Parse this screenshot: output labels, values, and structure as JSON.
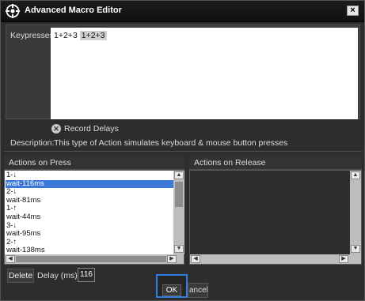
{
  "window": {
    "title": "Advanced Macro Editor",
    "close_glyph": "×"
  },
  "keypresses": {
    "label": "Keypresses:",
    "value_plain": "1+2+3",
    "value_selected": "1+2+3"
  },
  "record_delays": {
    "label": "Record Delays",
    "icon": "x-circle-icon"
  },
  "description": {
    "label": "Description:",
    "text": "This type of Action simulates keyboard & mouse button presses"
  },
  "actions_on_press": {
    "header": "Actions on Press",
    "items": [
      {
        "text": "1-↓"
      },
      {
        "text": "wait-116ms",
        "selected": true
      },
      {
        "text": "2-↓"
      },
      {
        "text": "wait-81ms"
      },
      {
        "text": "1-↑"
      },
      {
        "text": "wait-44ms"
      },
      {
        "text": "3-↓"
      },
      {
        "text": "wait-95ms"
      },
      {
        "text": "2-↑"
      },
      {
        "text": "wait-138ms"
      }
    ]
  },
  "actions_on_release": {
    "header": "Actions on Release"
  },
  "footer": {
    "delete_label": "Delete",
    "delay_label": "Delay (ms):",
    "delay_value": "116",
    "ok_label": "OK",
    "cancel_label": "ancel"
  },
  "colors": {
    "selection": "#3b78d8",
    "focus_ring": "#2d7de2"
  }
}
